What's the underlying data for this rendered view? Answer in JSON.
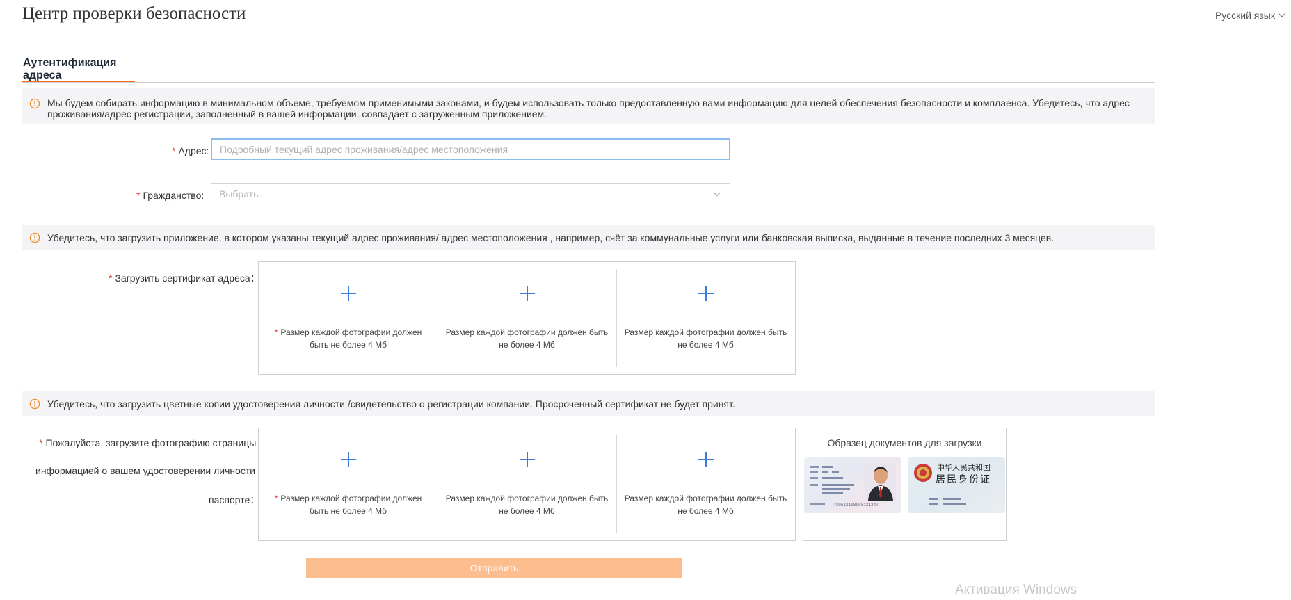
{
  "header": {
    "title": "Центр проверки безопасности",
    "language": "Русский язык"
  },
  "tabs": [
    {
      "label": "Аутентификация адреса",
      "active": true
    }
  ],
  "notices": {
    "intro": "Мы будем собирать информацию в минимальном объеме, требуемом применимыми законами, и будем использовать только предоставленную вами информацию для целей обеспечения безопасности и комплаенса. Убедитесь, что адрес проживания/адрес регистрации, заполненный в вашей информации, совпадает с загруженным приложением.",
    "address_proof": "Убедитесь, что загрузить приложение, в котором указаны текущий адрес проживания/ адрес местоположения , например, счёт за коммунальные услуги или банковская выписка, выданные в течение последних 3 месяцев.",
    "identity": "Убедитесь, что загрузить цветные копии удостоверения личности /свидетельство о регистрации компании. Просроченный сертификат не будет принят."
  },
  "form": {
    "address": {
      "label": "Адрес:",
      "placeholder": "Подробный  текущий  адрес проживания/адрес местоположения",
      "value": ""
    },
    "citizenship": {
      "label": "Гражданство:",
      "placeholder": "Выбрать"
    },
    "address_certificate": {
      "label": "Загрузить сертификат адреса："
    },
    "identity_photo": {
      "label_lines": [
        "Пожалуйста, загрузите фотографию страницы с",
        "информацией о вашем удостоверении личности /",
        "паспорте："
      ]
    },
    "required_mark": "*"
  },
  "upload": {
    "hint": "Размер каждой фотографии должен быть не более 4 Мб"
  },
  "sample": {
    "title": "Образец документов для загрузки",
    "back_heading_line1": "中华人民共和国",
    "back_heading_line2": "居民身份证",
    "front_id_number": "430512198908131347"
  },
  "submit_label": "Отправить",
  "watermark": "Активация Windows",
  "colors": {
    "accent": "#ff6a1a",
    "required": "#e5352b",
    "plus": "#3d7be0",
    "submit_bg": "#fcbd8f",
    "notice_bg": "#f4f4f6",
    "warning_icon": "#f08a24"
  },
  "icons": {
    "warning": "warning-circle-icon",
    "chevron": "chevron-down-icon",
    "plus": "plus-icon"
  }
}
